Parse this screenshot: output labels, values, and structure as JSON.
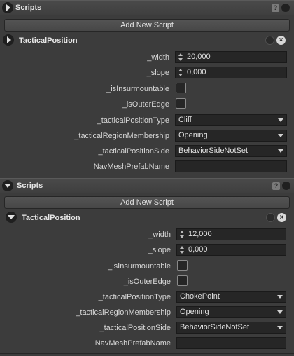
{
  "scripts_header": {
    "title": "Scripts",
    "help_label": "?"
  },
  "add_new_script_label": "Add New Script",
  "component_title": "TacticalPosition",
  "close_label": "×",
  "labels": {
    "width": "_width",
    "slope": "_slope",
    "is_insurmountable": "_isInsurmountable",
    "is_outer_edge": "_isOuterEdge",
    "tactical_position_type": "_tacticalPositionType",
    "tactical_region_membership": "_tacticalRegionMembership",
    "tactical_position_side": "_tacticalPositionSide",
    "navmesh_prefab_name": "NavMeshPrefabName"
  },
  "panels": [
    {
      "collapsed": true,
      "width": "20,000",
      "slope": "0,000",
      "is_insurmountable": false,
      "is_outer_edge": false,
      "tactical_position_type": "Cliff",
      "tactical_region_membership": "Opening",
      "tactical_position_side": "BehaviorSideNotSet",
      "navmesh_prefab_name": ""
    },
    {
      "collapsed": false,
      "width": "12,000",
      "slope": "0,000",
      "is_insurmountable": false,
      "is_outer_edge": false,
      "tactical_position_type": "ChokePoint",
      "tactical_region_membership": "Opening",
      "tactical_position_side": "BehaviorSideNotSet",
      "navmesh_prefab_name": ""
    }
  ]
}
